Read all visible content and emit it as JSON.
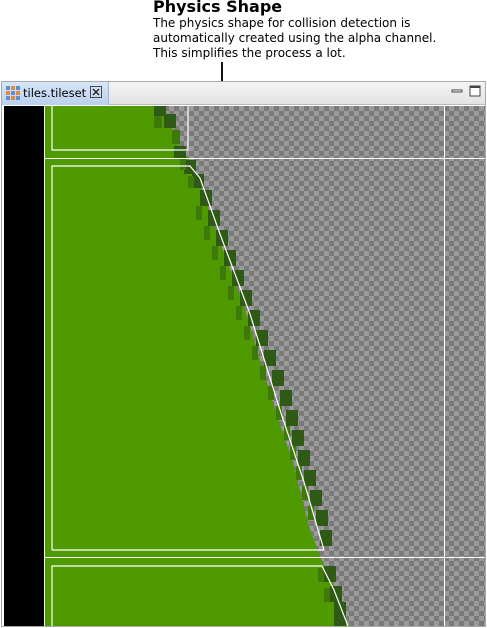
{
  "callout": {
    "title": "Physics Shape",
    "lines": [
      "The physics shape for collision detection is",
      "automatically created using the alpha channel.",
      "This simplifies the process a lot."
    ]
  },
  "editor": {
    "tab": {
      "label": "tiles.tileset",
      "icon": "tileset-grid-icon",
      "close_icon": "close-icon"
    },
    "window_controls": [
      "minimize-icon",
      "maximize-icon"
    ],
    "colors": {
      "grass": "#4e9a00",
      "grass_edge_dark": "#2f5a15",
      "grass_edge_mid": "#3d7a0a",
      "checker_light": "#9a9a9a",
      "checker_dark": "#7a7a7a",
      "canvas_bg": "#000000",
      "hull_line": "#ffffff"
    }
  }
}
